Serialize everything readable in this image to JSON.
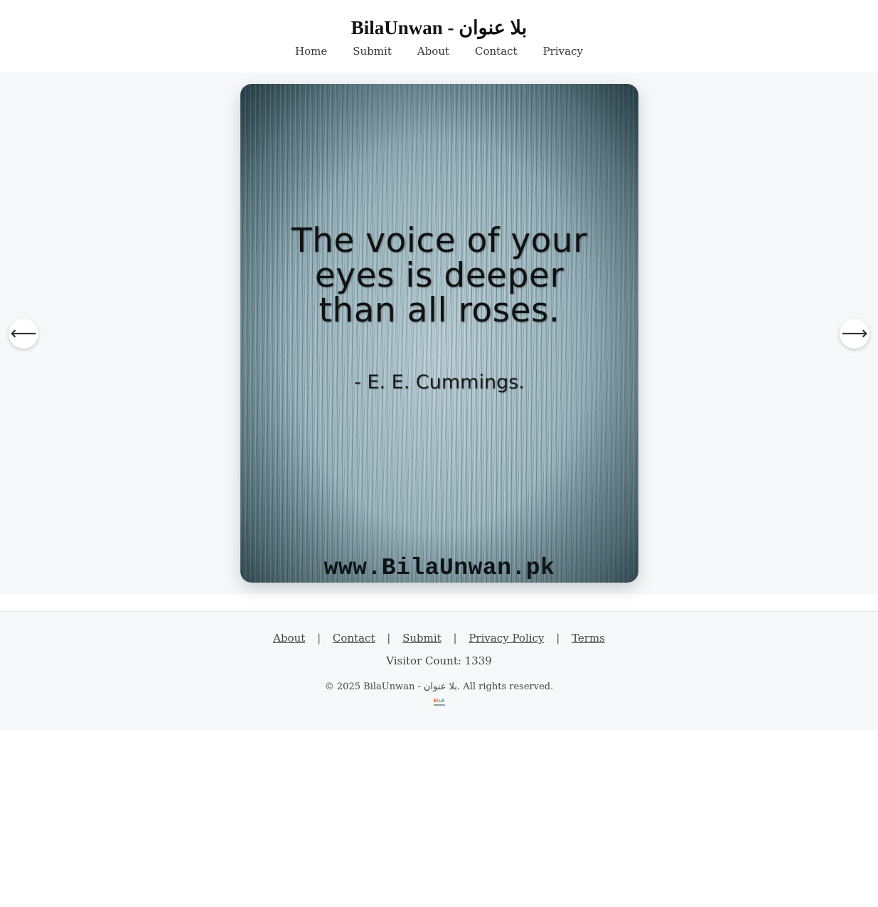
{
  "header": {
    "title": "BilaUnwan - بلا عنوان",
    "nav": [
      "Home",
      "Submit",
      "About",
      "Contact",
      "Privacy"
    ]
  },
  "slide": {
    "quote": "The voice of your\neyes is deeper\nthan all roses.",
    "author": "- E. E. Cummings.",
    "url": "www.BilaUnwan.pk"
  },
  "controls": {
    "prev_icon": "⟵",
    "next_icon": "⟶",
    "prev_icon_name": "arrow-left-icon",
    "next_icon_name": "arrow-right-icon"
  },
  "footer": {
    "links": [
      "About",
      "Contact",
      "Submit",
      "Privacy Policy",
      "Terms"
    ],
    "separator": "|",
    "visitor_count": "Visitor Count: 1339",
    "copyright": "© 2025 BilaUnwan - بلا عنوان. All rights reserved."
  },
  "colors": {
    "stage_bg": "#f7f8fa",
    "text": "#222222"
  }
}
